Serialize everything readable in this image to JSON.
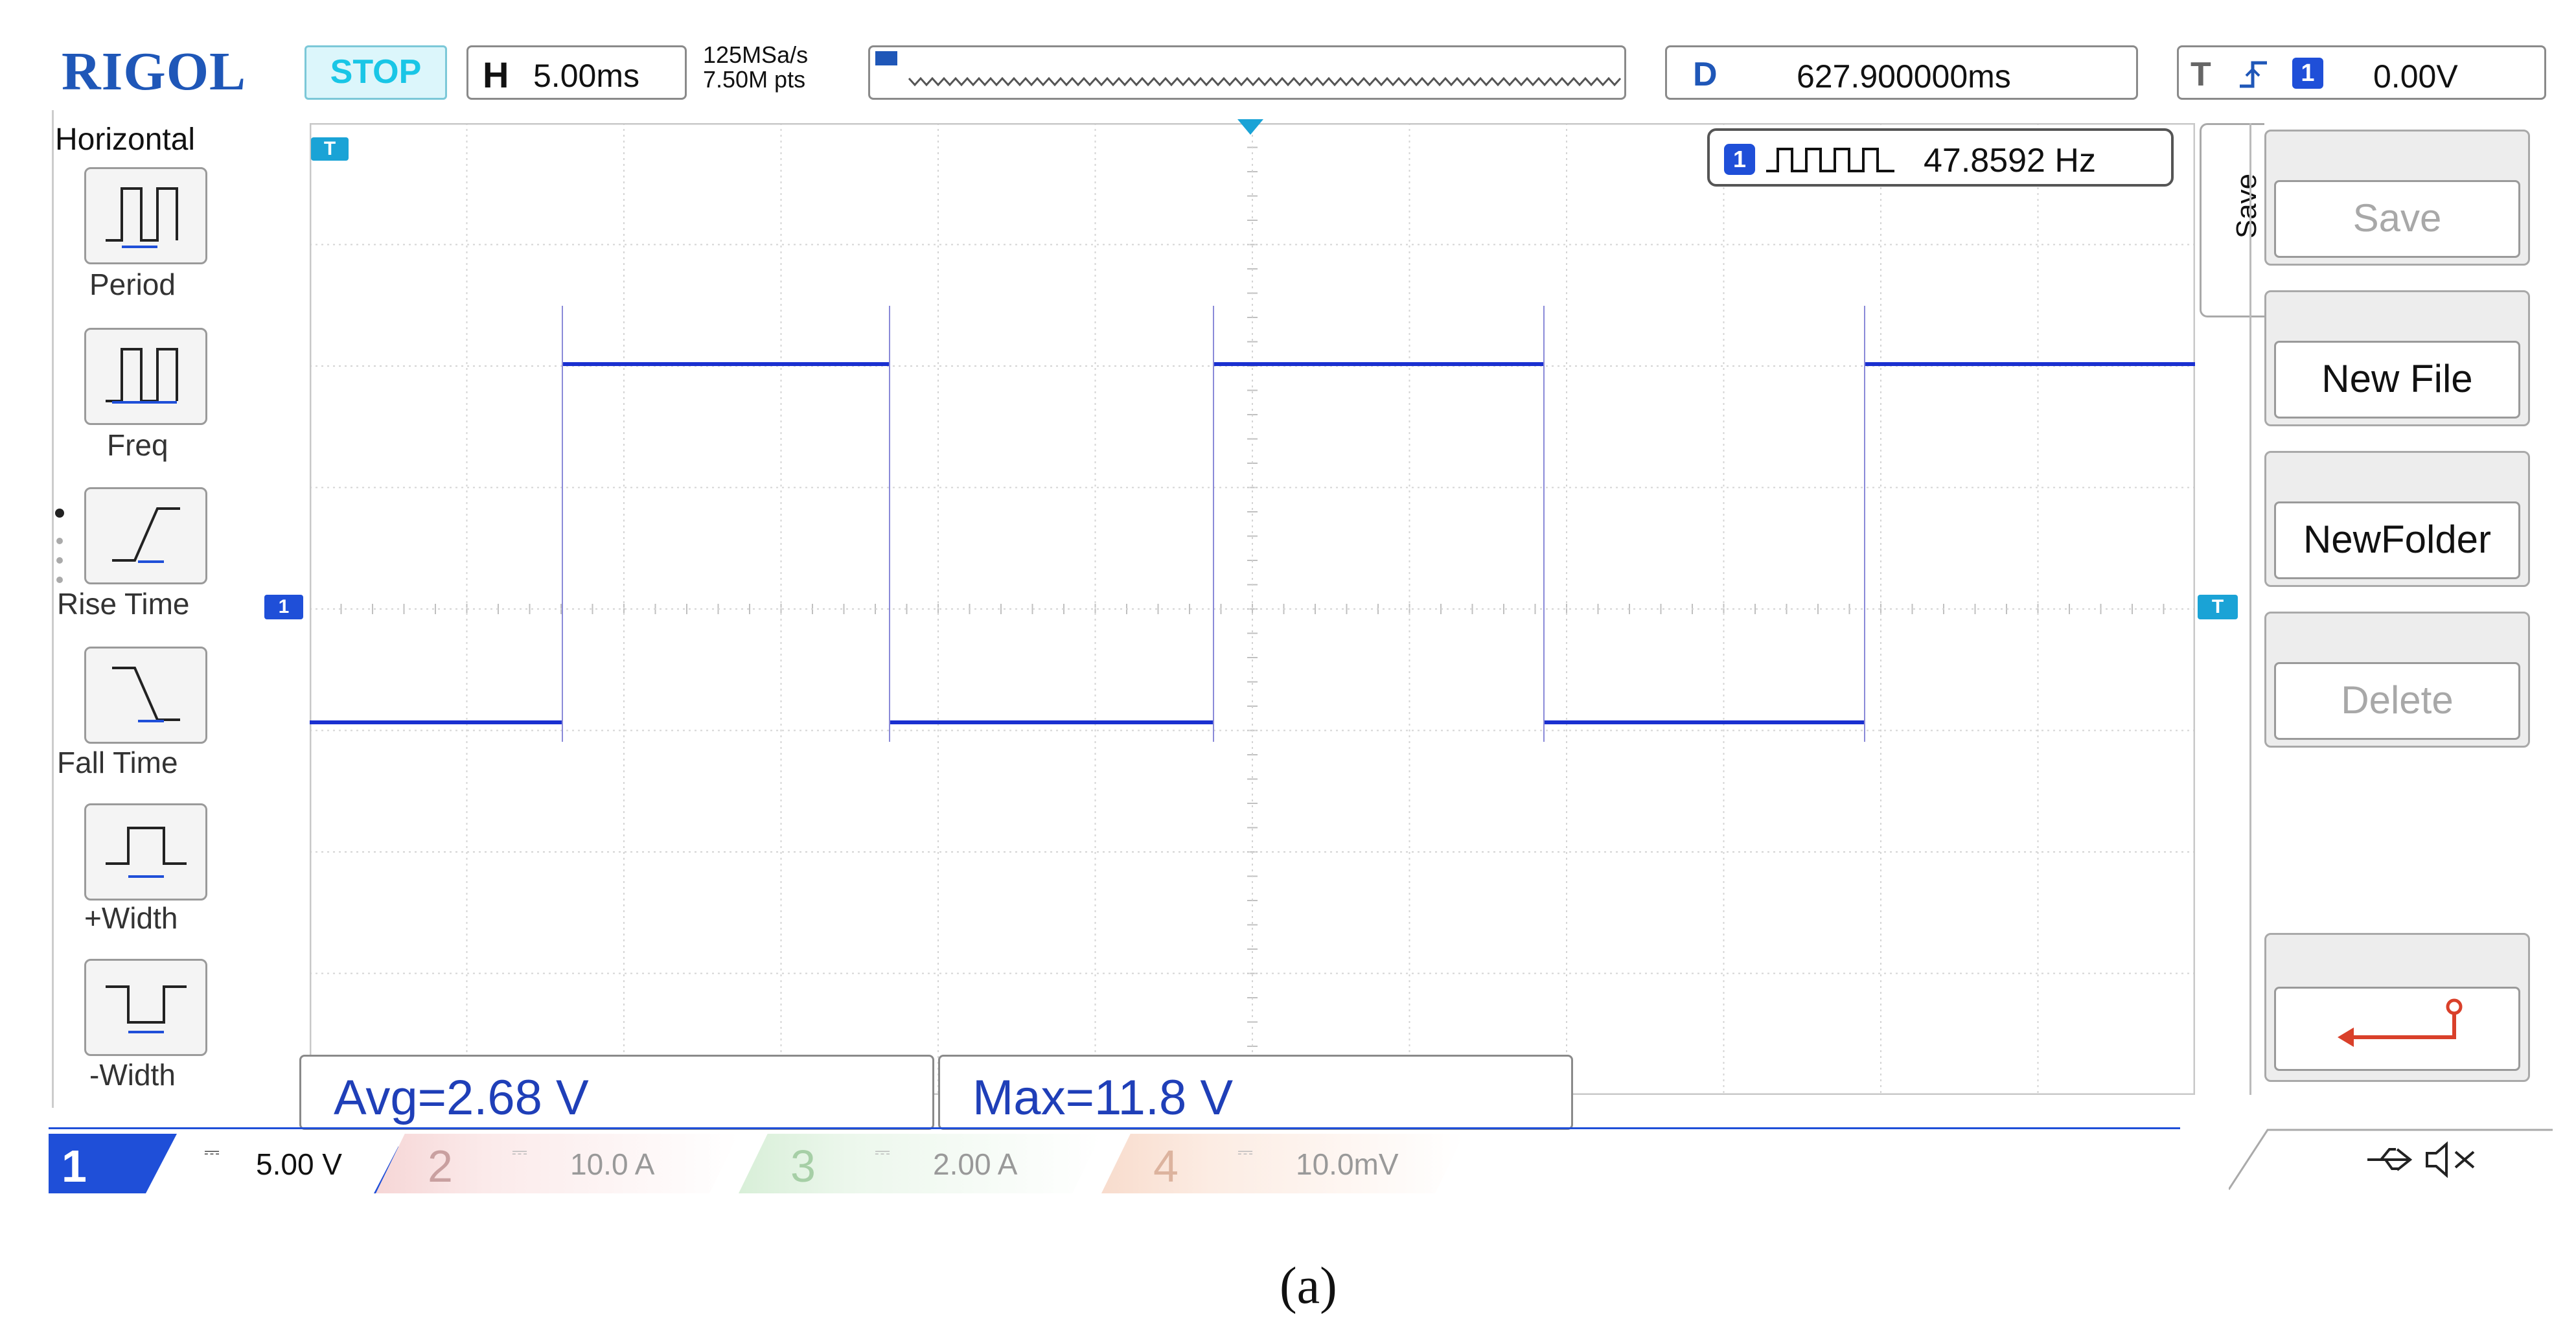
{
  "header": {
    "logo": "RIGOL",
    "run_state": "STOP",
    "timebase_key": "H",
    "timebase_value": "5.00ms",
    "sample_rate": "125MSa/s",
    "memory_depth": "7.50M pts",
    "delay_key": "D",
    "delay_value": "627.900000ms",
    "trigger_key": "T",
    "trigger_level": "0.00V",
    "trigger_channel": "1"
  },
  "left_menu": {
    "title": "Horizontal",
    "items": [
      {
        "label": "Period",
        "icon": "period-icon"
      },
      {
        "label": "Freq",
        "icon": "freq-icon"
      },
      {
        "label": "Rise Time",
        "icon": "rise-time-icon"
      },
      {
        "label": "Fall Time",
        "icon": "fall-time-icon"
      },
      {
        "label": "+Width",
        "icon": "plus-width-icon"
      },
      {
        "label": "-Width",
        "icon": "minus-width-icon"
      }
    ]
  },
  "frequency_counter": {
    "channel": "1",
    "value": "47.8592 Hz"
  },
  "markers": {
    "trigger_marker": "T",
    "channel_marker": "1"
  },
  "measurements": {
    "avg": "Avg=2.68 V",
    "max": "Max=11.8 V"
  },
  "right_menu": {
    "tab_label": "Save",
    "items": [
      {
        "label": "Save",
        "disabled": true
      },
      {
        "label": "New File",
        "disabled": false
      },
      {
        "label": "NewFolder",
        "disabled": false
      },
      {
        "label": "Delete",
        "disabled": true
      }
    ],
    "back_icon": "return-arrow-icon"
  },
  "channels": [
    {
      "num": "1",
      "scale": "5.00 V",
      "color": "#1f4fd8",
      "active": true
    },
    {
      "num": "2",
      "scale": "10.0 A",
      "color": "#e8a0a0",
      "active": false
    },
    {
      "num": "3",
      "scale": "2.00 A",
      "color": "#9fd39f",
      "active": false
    },
    {
      "num": "4",
      "scale": "10.0mV",
      "color": "#f0b59a",
      "active": false
    }
  ],
  "status_icons": [
    "usb-icon",
    "speaker-mute-icon"
  ],
  "caption": "(a)",
  "colors": {
    "trace": "#1a30d0",
    "logo": "#1f57b8",
    "stop": "#19c6e6"
  }
}
